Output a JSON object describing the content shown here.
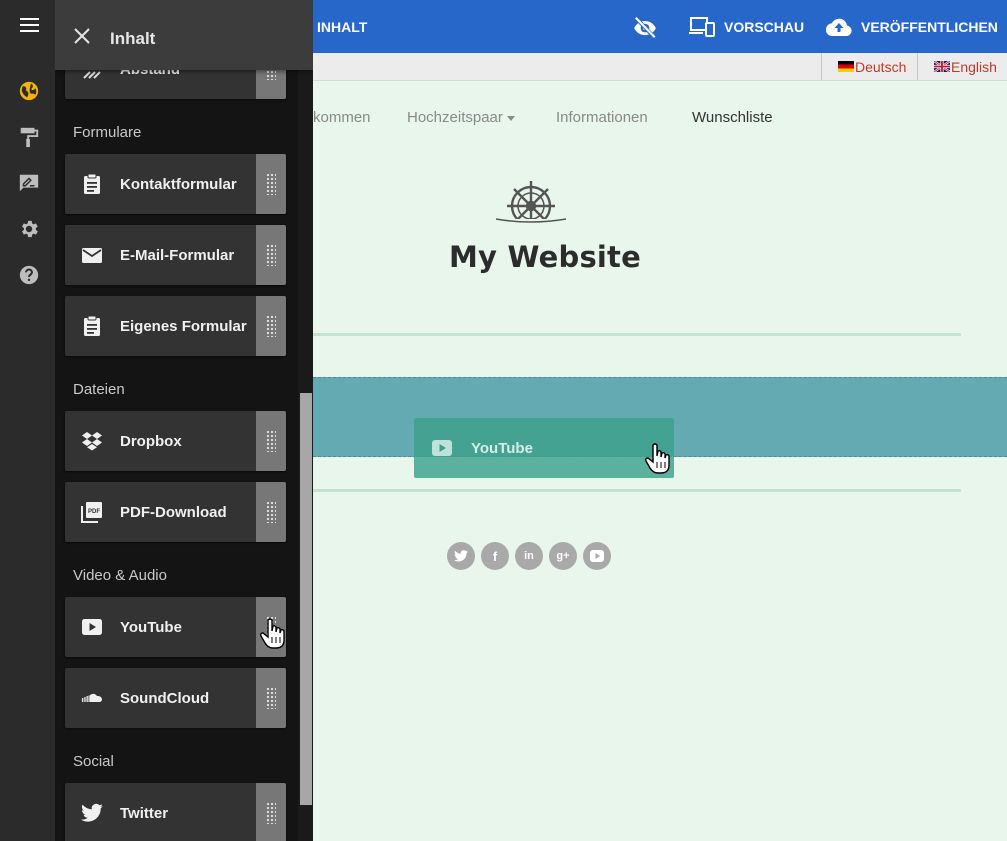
{
  "topbar": {
    "tab_label": "INHALT",
    "preview_label": "VORSCHAU",
    "publish_label": "VERÖFFENTLICHEN"
  },
  "languages": [
    "Deutsch",
    "English"
  ],
  "site": {
    "nav": [
      "kommen",
      "Hochzeitspaar",
      "Informationen",
      "Wunschliste"
    ],
    "title": "My Website",
    "drag_label": "YouTube",
    "socials": [
      "twitter",
      "facebook",
      "linkedin",
      "google-plus",
      "youtube"
    ]
  },
  "panel": {
    "title": "Inhalt",
    "partial_item": "Abstand",
    "sections": {
      "forms": "Formulare",
      "files": "Dateien",
      "media": "Video & Audio",
      "social": "Social"
    },
    "items": {
      "contact": "Kontaktformular",
      "email": "E-Mail-Formular",
      "custom": "Eigenes Formular",
      "dropbox": "Dropbox",
      "pdf": "PDF-Download",
      "youtube": "YouTube",
      "soundcloud": "SoundCloud",
      "twitter": "Twitter"
    }
  },
  "colors": {
    "topbar": "#2767c9",
    "rail": "#2b2b2b",
    "panel": "#141414",
    "page_bg": "#e8f6ec",
    "drop_zone": "#63aab3",
    "accent_globe": "#f4b400"
  }
}
